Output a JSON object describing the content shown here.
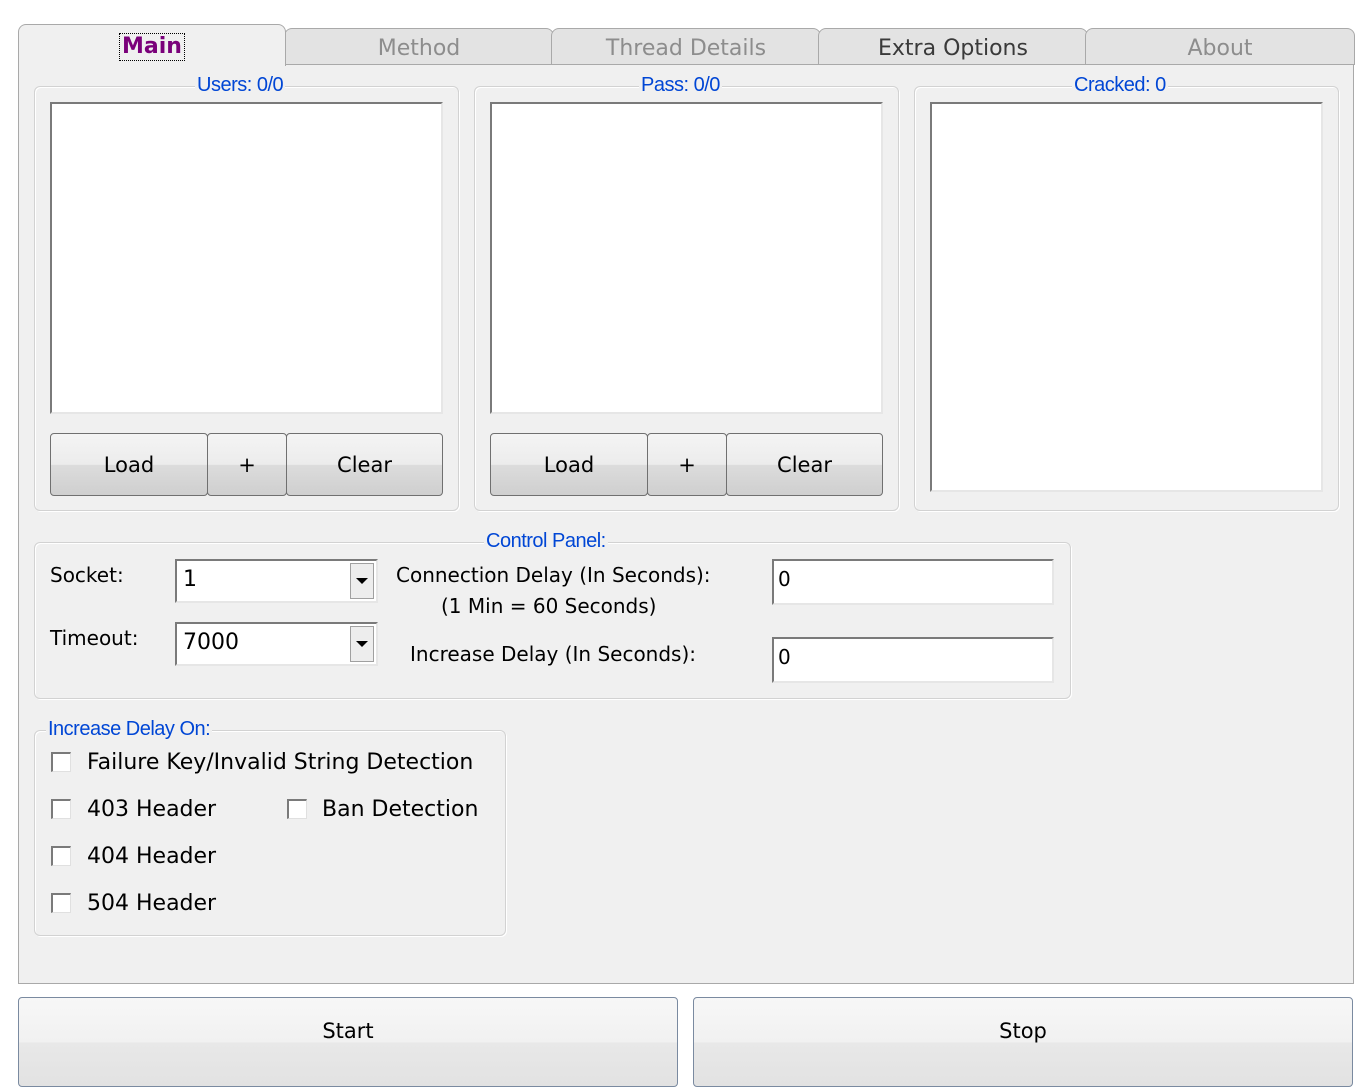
{
  "tabs": [
    {
      "label": "Main",
      "active": true
    },
    {
      "label": "Method",
      "active": false
    },
    {
      "label": "Thread Details",
      "active": false
    },
    {
      "label": "Extra Options",
      "active": false
    },
    {
      "label": "About",
      "active": false
    }
  ],
  "users": {
    "legend": "Users: 0/0",
    "load": "Load",
    "add": "+",
    "clear": "Clear"
  },
  "pass": {
    "legend": "Pass: 0/0",
    "load": "Load",
    "add": "+",
    "clear": "Clear"
  },
  "cracked": {
    "legend": "Cracked: 0"
  },
  "control_panel": {
    "legend": "Control Panel:",
    "socket_label": "Socket:",
    "socket_value": "1",
    "timeout_label": "Timeout:",
    "timeout_value": "7000",
    "connection_delay_label": "Connection Delay (In Seconds):",
    "connection_delay_hint": "(1 Min = 60 Seconds)",
    "connection_delay_value": "0",
    "increase_delay_label": "Increase Delay (In Seconds):",
    "increase_delay_value": "0"
  },
  "increase_delay_on": {
    "legend": "Increase Delay On:",
    "failure_key": "Failure Key/Invalid String Detection",
    "header_403": "403 Header",
    "ban_detection": "Ban Detection",
    "header_404": "404 Header",
    "header_504": "504 Header"
  },
  "actions": {
    "start": "Start",
    "stop": "Stop"
  },
  "colors": {
    "legend": "#0046d5",
    "active_tab": "#7a007a",
    "panel_bg": "#f0f0f0"
  }
}
